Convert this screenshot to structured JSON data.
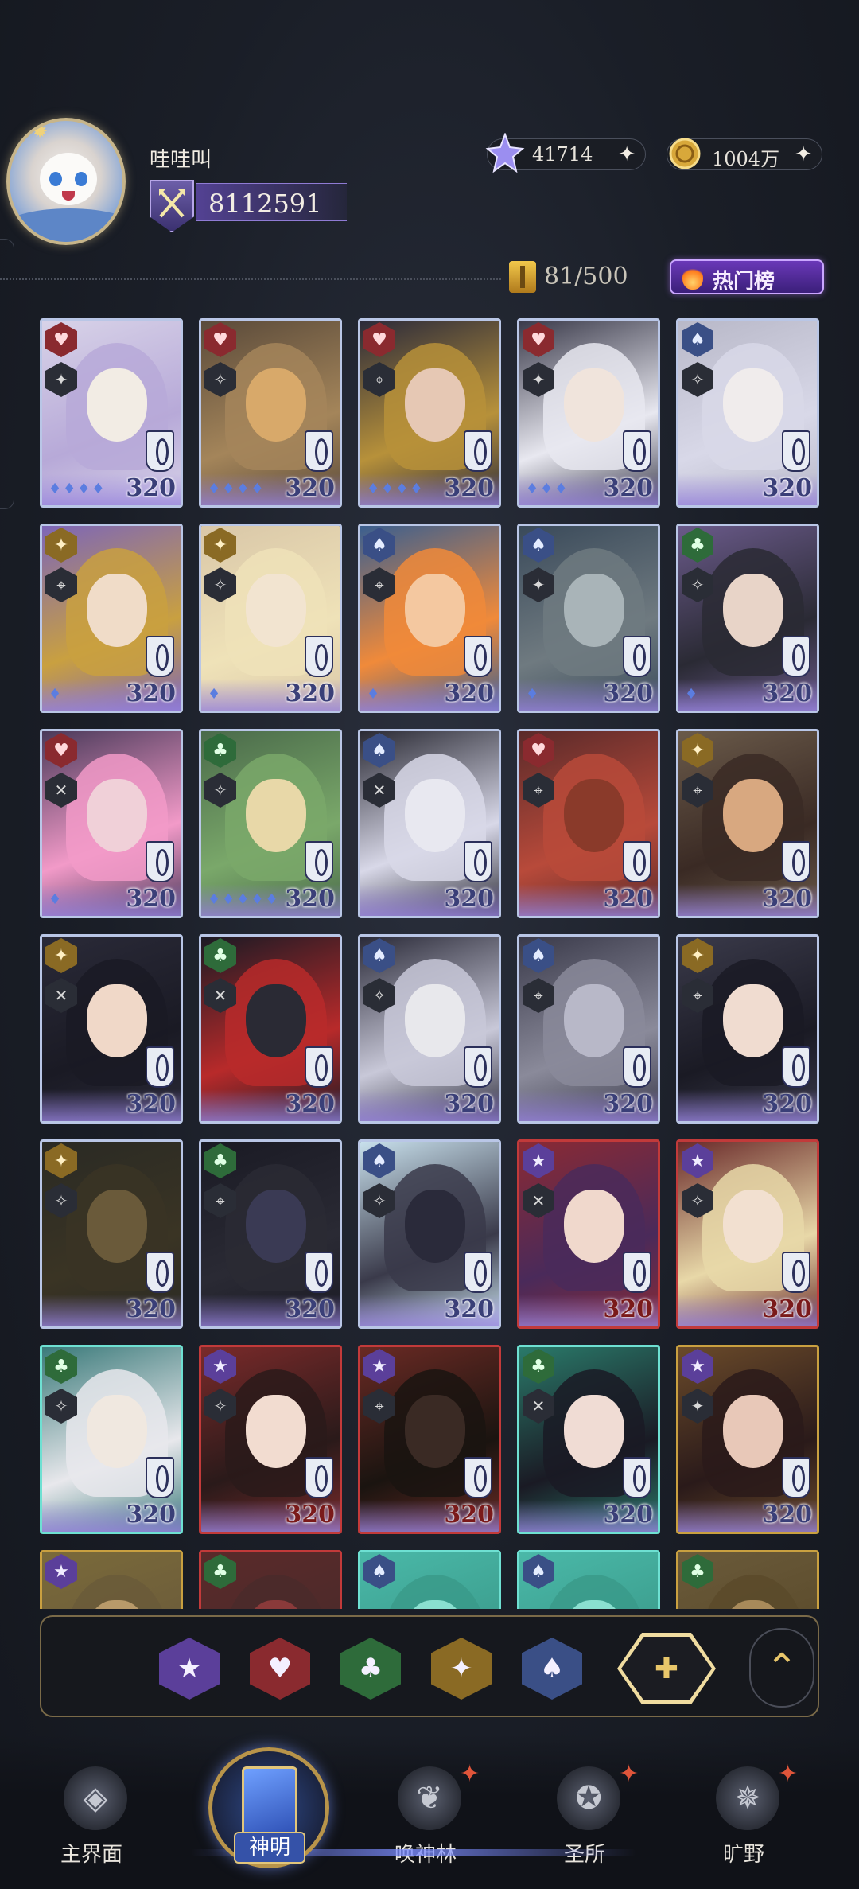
{
  "player": {
    "name": "哇哇叫",
    "power": "8112591"
  },
  "currency": {
    "gems": "41714",
    "gold": "1004万"
  },
  "collection": {
    "count": "81/500",
    "hot_label": "热门榜"
  },
  "cards": [
    {
      "element": "heart",
      "element_glyph": "♥",
      "class_glyph": "✦",
      "level": "320",
      "stars": "♦♦♦♦",
      "frame": "blue",
      "art": [
        "#d8d3e8",
        "#f2ece4",
        "#b7a9d8"
      ]
    },
    {
      "element": "heart",
      "element_glyph": "♥",
      "class_glyph": "✧",
      "level": "320",
      "stars": "♦♦♦♦",
      "frame": "blue",
      "art": [
        "#5a4a3a",
        "#d8a96a",
        "#a4855a"
      ]
    },
    {
      "element": "heart",
      "element_glyph": "♥",
      "class_glyph": "⌖",
      "level": "320",
      "stars": "♦♦♦♦",
      "frame": "blue",
      "art": [
        "#2b2a3a",
        "#e6c8b4",
        "#b7913a"
      ]
    },
    {
      "element": "heart",
      "element_glyph": "♥",
      "class_glyph": "✦",
      "level": "320",
      "stars": "♦♦♦",
      "frame": "blue",
      "art": [
        "#3a3a4a",
        "#f0e4dc",
        "#e8e8f0"
      ]
    },
    {
      "element": "spade",
      "element_glyph": "♠",
      "class_glyph": "✧",
      "level": "320",
      "stars": "",
      "frame": "blue",
      "art": [
        "#b8b8c8",
        "#f0ecec",
        "#d8d8e8"
      ]
    },
    {
      "element": "star4",
      "element_glyph": "✦",
      "class_glyph": "⌖",
      "level": "320",
      "stars": "♦",
      "frame": "blue",
      "art": [
        "#7d66b8",
        "#f0dcc8",
        "#c9a040"
      ]
    },
    {
      "element": "star4",
      "element_glyph": "✦",
      "class_glyph": "✧",
      "level": "320",
      "stars": "♦",
      "frame": "blue",
      "art": [
        "#d9c7a8",
        "#f2e4d0",
        "#efe2b8"
      ]
    },
    {
      "element": "spade",
      "element_glyph": "♠",
      "class_glyph": "⌖",
      "level": "320",
      "stars": "♦",
      "frame": "blue",
      "art": [
        "#3b5f8f",
        "#f4c8a0",
        "#f08a3a"
      ]
    },
    {
      "element": "spade",
      "element_glyph": "♠",
      "class_glyph": "✦",
      "level": "320",
      "stars": "♦",
      "frame": "blue",
      "art": [
        "#3a4a5a",
        "#a9b4b8",
        "#6f7a80"
      ]
    },
    {
      "element": "club",
      "element_glyph": "♣",
      "class_glyph": "✧",
      "level": "320",
      "stars": "♦",
      "frame": "blue",
      "art": [
        "#6a5a8a",
        "#e8d4c8",
        "#2a2a34"
      ]
    },
    {
      "element": "heart",
      "element_glyph": "♥",
      "class_glyph": "✕",
      "level": "320",
      "stars": "♦",
      "frame": "blue",
      "art": [
        "#4a3a5a",
        "#f0d0d8",
        "#f29ac8"
      ]
    },
    {
      "element": "club",
      "element_glyph": "♣",
      "class_glyph": "✧",
      "level": "320",
      "stars": "♦♦♦♦♦",
      "frame": "blue",
      "art": [
        "#4a6a4a",
        "#e8d8a8",
        "#7aa86a"
      ]
    },
    {
      "element": "spade",
      "element_glyph": "♠",
      "class_glyph": "✕",
      "level": "320",
      "stars": "",
      "frame": "blue",
      "art": [
        "#2a2a34",
        "#e8e8f0",
        "#d8d8e8"
      ]
    },
    {
      "element": "heart",
      "element_glyph": "♥",
      "class_glyph": "⌖",
      "level": "320",
      "stars": "",
      "frame": "blue",
      "art": [
        "#5a2a2a",
        "#8a3a2a",
        "#b84a3a"
      ]
    },
    {
      "element": "star4",
      "element_glyph": "✦",
      "class_glyph": "⌖",
      "level": "320",
      "stars": "",
      "frame": "blue",
      "art": [
        "#6a5a4a",
        "#d8a880",
        "#3a2a24"
      ]
    },
    {
      "element": "star4",
      "element_glyph": "✦",
      "class_glyph": "✕",
      "level": "320",
      "stars": "",
      "frame": "blue",
      "art": [
        "#2a2a38",
        "#f0d8c8",
        "#1a1a24"
      ]
    },
    {
      "element": "club",
      "element_glyph": "♣",
      "class_glyph": "✕",
      "level": "320",
      "stars": "",
      "frame": "blue",
      "art": [
        "#1a1a24",
        "#2a2a34",
        "#b82a2a"
      ]
    },
    {
      "element": "spade",
      "element_glyph": "♠",
      "class_glyph": "✧",
      "level": "320",
      "stars": "",
      "frame": "blue",
      "art": [
        "#2a2a38",
        "#e8e8ec",
        "#c8c8d8"
      ]
    },
    {
      "element": "spade",
      "element_glyph": "♠",
      "class_glyph": "⌖",
      "level": "320",
      "stars": "",
      "frame": "blue",
      "art": [
        "#3a3a4a",
        "#b8b8c8",
        "#8a8a9a"
      ]
    },
    {
      "element": "star4",
      "element_glyph": "✦",
      "class_glyph": "⌖",
      "level": "320",
      "stars": "",
      "frame": "blue",
      "art": [
        "#3a3a4a",
        "#f0dcd0",
        "#1a1a24"
      ]
    },
    {
      "element": "star4",
      "element_glyph": "✦",
      "class_glyph": "✧",
      "level": "320",
      "stars": "",
      "frame": "blue",
      "art": [
        "#2a2a24",
        "#6a5a3a",
        "#3a3424"
      ]
    },
    {
      "element": "club",
      "element_glyph": "♣",
      "class_glyph": "⌖",
      "level": "320",
      "stars": "",
      "frame": "blue",
      "art": [
        "#1a1a24",
        "#3a3a54",
        "#2a2a34"
      ]
    },
    {
      "element": "spade",
      "element_glyph": "♠",
      "class_glyph": "✧",
      "level": "320",
      "stars": "",
      "frame": "blue",
      "art": [
        "#c8e0ec",
        "#2a2a3a",
        "#3a3a4a"
      ]
    },
    {
      "element": "star",
      "element_glyph": "★",
      "class_glyph": "✕",
      "level": "320",
      "stars": "",
      "frame": "red",
      "art": [
        "#8a2a34",
        "#f0d8cc",
        "#4a2a5a"
      ]
    },
    {
      "element": "star",
      "element_glyph": "★",
      "class_glyph": "✧",
      "level": "320",
      "stars": "",
      "frame": "red",
      "art": [
        "#6a2a2a",
        "#f2e0d0",
        "#e8d8a8"
      ]
    },
    {
      "element": "club",
      "element_glyph": "♣",
      "class_glyph": "✧",
      "level": "320",
      "stars": "",
      "frame": "teal",
      "art": [
        "#3a7a7a",
        "#f0e8e0",
        "#e8e8ec"
      ]
    },
    {
      "element": "star",
      "element_glyph": "★",
      "class_glyph": "✧",
      "level": "320",
      "stars": "",
      "frame": "red",
      "art": [
        "#7a2a2a",
        "#f2dcd0",
        "#2a1a1a"
      ]
    },
    {
      "element": "star",
      "element_glyph": "★",
      "class_glyph": "⌖",
      "level": "320",
      "stars": "",
      "frame": "red",
      "art": [
        "#6a2a24",
        "#3a2a24",
        "#1a1410"
      ]
    },
    {
      "element": "club",
      "element_glyph": "♣",
      "class_glyph": "✕",
      "level": "320",
      "stars": "",
      "frame": "teal",
      "art": [
        "#2a7a6a",
        "#f0dcd4",
        "#1a1a24"
      ]
    },
    {
      "element": "star",
      "element_glyph": "★",
      "class_glyph": "✦",
      "level": "320",
      "stars": "",
      "frame": "gold",
      "art": [
        "#6a4a2a",
        "#e8c8b8",
        "#2a1a1a"
      ]
    },
    {
      "element": "star",
      "element_glyph": "★",
      "class_glyph": "",
      "level": "",
      "stars": "",
      "frame": "gold",
      "art": [
        "#7a6a3a",
        "#b89a6a",
        "#6a5a3a"
      ]
    },
    {
      "element": "club",
      "element_glyph": "♣",
      "class_glyph": "",
      "level": "",
      "stars": "",
      "frame": "red",
      "art": [
        "#5a2a2a",
        "#8a3a3a",
        "#4a2a2a"
      ]
    },
    {
      "element": "spade",
      "element_glyph": "♠",
      "class_glyph": "",
      "level": "",
      "stars": "",
      "frame": "teal",
      "art": [
        "#4ab8a8",
        "#8ae0d0",
        "#3a9a8a"
      ]
    },
    {
      "element": "spade",
      "element_glyph": "♠",
      "class_glyph": "",
      "level": "",
      "stars": "",
      "frame": "teal",
      "art": [
        "#4ab8a8",
        "#8ae0d0",
        "#3a9a8a"
      ]
    },
    {
      "element": "club",
      "element_glyph": "♣",
      "class_glyph": "",
      "level": "",
      "stars": "",
      "frame": "gold",
      "art": [
        "#6a5a3a",
        "#a88a5a",
        "#5a4a2a"
      ]
    }
  ],
  "filters": [
    {
      "name": "star",
      "glyph": "★",
      "color": "#5b3f9a"
    },
    {
      "name": "heart",
      "glyph": "♥",
      "color": "#8a2a2f"
    },
    {
      "name": "club",
      "glyph": "♣",
      "color": "#2e6b3a"
    },
    {
      "name": "star4",
      "glyph": "✦",
      "color": "#8a6a24"
    },
    {
      "name": "spade",
      "glyph": "♠",
      "color": "#3a4f86"
    },
    {
      "name": "all",
      "glyph": "✚",
      "color": "#f0dca0",
      "selected": true
    }
  ],
  "nav": {
    "main": "主界面",
    "gods": "神明",
    "summon": "唤神林",
    "sanctuary": "圣所",
    "wilds": "旷野"
  }
}
